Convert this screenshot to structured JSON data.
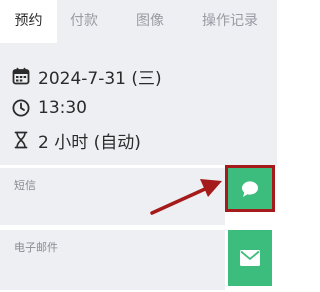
{
  "tabs": [
    {
      "label": "预约",
      "active": true
    },
    {
      "label": "付款",
      "active": false
    },
    {
      "label": "图像",
      "active": false
    },
    {
      "label": "操作记录",
      "active": false
    }
  ],
  "appointment": {
    "date": "2024-7-31 (三)",
    "time": "13:30",
    "duration": "2 小时 (自动)"
  },
  "fields": {
    "sms_label": "短信",
    "email_label": "电子邮件"
  },
  "colors": {
    "accent_green": "#3dbd7d",
    "highlight_red": "#a51a1a",
    "panel_bg": "#eeeff3"
  },
  "icons": {
    "date": "calendar-icon",
    "time": "clock-icon",
    "duration": "hourglass-icon",
    "sms": "chat-bubble-icon",
    "email": "envelope-icon"
  }
}
